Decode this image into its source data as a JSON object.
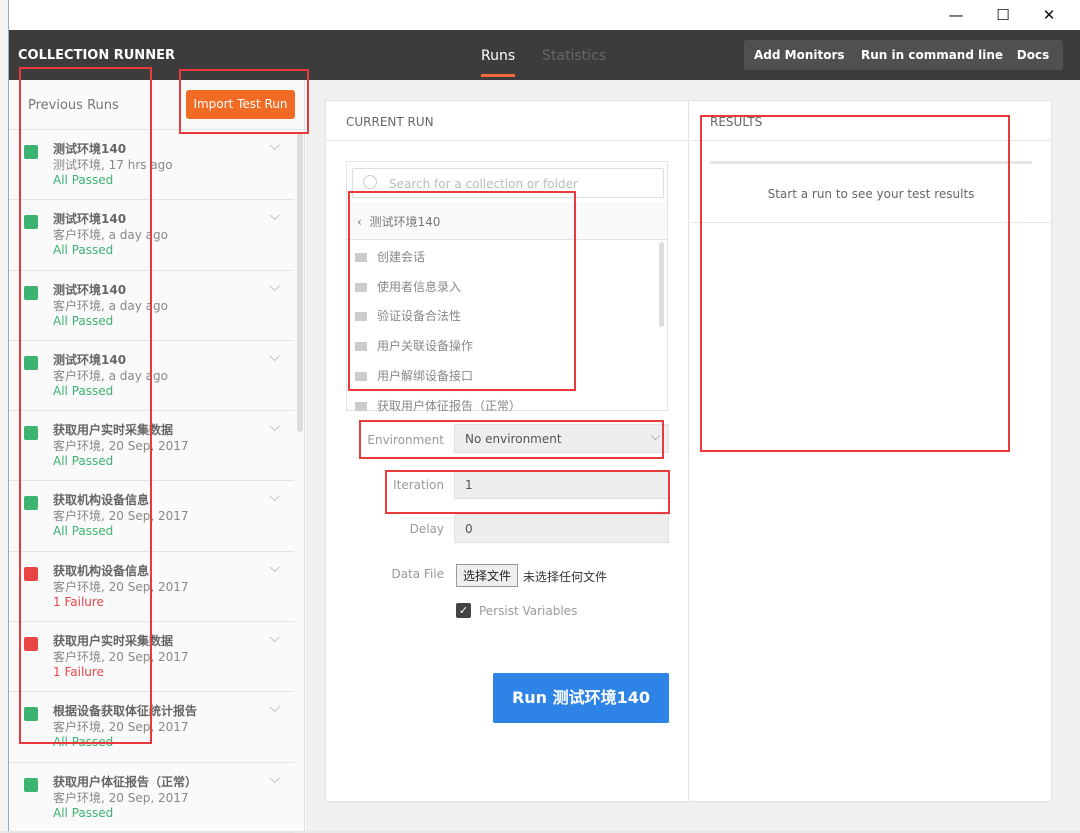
{
  "window": {
    "minimize": "—",
    "maximize": "☐",
    "close": "✕"
  },
  "header": {
    "title": "COLLECTION RUNNER",
    "tabs": [
      {
        "label": "Runs",
        "active": true
      },
      {
        "label": "Statistics",
        "active": false
      }
    ],
    "buttons": [
      "Add Monitors",
      "Run in command line",
      "Docs"
    ]
  },
  "sidebar": {
    "title": "Previous Runs",
    "import_label": "Import Test Run",
    "runs": [
      {
        "name": "测试环境140",
        "sub": "测试环境, 17 hrs ago",
        "status": "All Passed",
        "ok": true
      },
      {
        "name": "测试环境140",
        "sub": "客户环境, a day ago",
        "status": "All Passed",
        "ok": true
      },
      {
        "name": "测试环境140",
        "sub": "客户环境, a day ago",
        "status": "All Passed",
        "ok": true
      },
      {
        "name": "测试环境140",
        "sub": "客户环境, a day ago",
        "status": "All Passed",
        "ok": true
      },
      {
        "name": "获取用户实时采集数据",
        "sub": "客户环境, 20 Sep, 2017",
        "status": "All Passed",
        "ok": true
      },
      {
        "name": "获取机构设备信息",
        "sub": "客户环境, 20 Sep, 2017",
        "status": "All Passed",
        "ok": true
      },
      {
        "name": "获取机构设备信息",
        "sub": "客户环境, 20 Sep, 2017",
        "status": "1 Failure",
        "ok": false
      },
      {
        "name": "获取用户实时采集数据",
        "sub": "客户环境, 20 Sep, 2017",
        "status": "1 Failure",
        "ok": false
      },
      {
        "name": "根据设备获取体征统计报告",
        "sub": "客户环境, 20 Sep, 2017",
        "status": "All Passed",
        "ok": true
      },
      {
        "name": "获取用户体征报告（正常）",
        "sub": "客户环境, 20 Sep, 2017",
        "status": "All Passed",
        "ok": true
      }
    ]
  },
  "current_run": {
    "title": "CURRENT RUN",
    "search_placeholder": "Search for a collection or folder",
    "collection": "测试环境140",
    "folders": [
      "创建会话",
      "使用者信息录入",
      "验证设备合法性",
      "用户关联设备操作",
      "用户解绑设备接口",
      "获取用户体征报告（正常）"
    ],
    "environment_label": "Environment",
    "environment_value": "No environment",
    "iteration_label": "Iteration",
    "iteration_value": "1",
    "delay_label": "Delay",
    "delay_value": "0",
    "datafile_label": "Data File",
    "choose_file": "选择文件",
    "no_file": "未选择任何文件",
    "persist_label": "Persist Variables",
    "persist_checked": true,
    "run_label": "Run 测试环境140"
  },
  "results": {
    "title": "RESULTS",
    "empty": "Start a run to see your test results"
  },
  "colors": {
    "passed": "#3cb371",
    "failed": "#e84545",
    "accent": "#f26b24",
    "run": "#2d83e6"
  }
}
